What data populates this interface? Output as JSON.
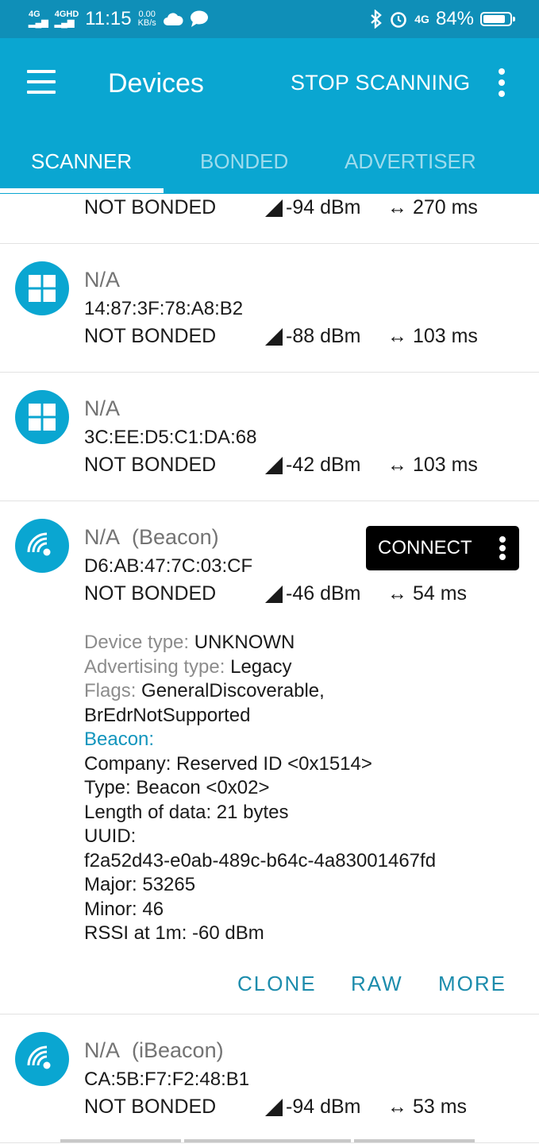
{
  "status_bar": {
    "network1": "4G",
    "network2": "4GHD",
    "time": "11:15",
    "speed_value": "0.00",
    "speed_unit": "KB/s",
    "network3": "4G",
    "battery": "84%",
    "battery_level": 0.84
  },
  "app_bar": {
    "title": "Devices",
    "stop_scanning": "STOP SCANNING"
  },
  "tabs": [
    {
      "label": "SCANNER"
    },
    {
      "label": "BONDED"
    },
    {
      "label": "ADVERTISER"
    }
  ],
  "devices": [
    {
      "bond": "NOT BONDED",
      "rssi": "-94 dBm",
      "interval": "270 ms"
    },
    {
      "icon": "windows-icon",
      "name": "N/A",
      "address": "14:87:3F:78:A8:B2",
      "bond": "NOT BONDED",
      "rssi": "-88 dBm",
      "interval": "103 ms"
    },
    {
      "icon": "windows-icon",
      "name": "N/A",
      "address": "3C:EE:D5:C1:DA:68",
      "bond": "NOT BONDED",
      "rssi": "-42 dBm",
      "interval": "103 ms"
    },
    {
      "icon": "beacon-icon",
      "name": "N/A",
      "name_suffix": "(Beacon)",
      "address": "D6:AB:47:7C:03:CF",
      "bond": "NOT BONDED",
      "rssi": "-46 dBm",
      "interval": "54 ms"
    },
    {
      "icon": "beacon-icon",
      "name": "N/A",
      "name_suffix": "(iBeacon)",
      "address": "CA:5B:F7:F2:48:B1",
      "bond": "NOT BONDED",
      "rssi": "-94 dBm",
      "interval": "53 ms"
    }
  ],
  "expanded": {
    "connect": "CONNECT",
    "device_type_label": "Device type:",
    "device_type_value": "UNKNOWN",
    "adv_type_label": "Advertising type:",
    "adv_type_value": "Legacy",
    "flags_label": "Flags:",
    "flags_value_1": "GeneralDiscoverable,",
    "flags_value_2": "BrEdrNotSupported",
    "beacon_header": "Beacon:",
    "company": "Company: Reserved ID <0x1514>",
    "type": "Type: Beacon <0x02>",
    "length": "Length of data: 21 bytes",
    "uuid_label": "UUID:",
    "uuid_value": "f2a52d43-e0ab-489c-b64c-4a83001467fd",
    "major": "Major: 53265",
    "minor": "Minor: 46",
    "rssi_1m": "RSSI at 1m: -60 dBm",
    "actions": {
      "clone": "CLONE",
      "raw": "RAW",
      "more": "MORE"
    }
  },
  "colors": {
    "status_bar": "#0f8fb8",
    "app_bar": "#0aa6d1",
    "accent_text": "#1295bd",
    "action_text": "#1c8cac"
  }
}
